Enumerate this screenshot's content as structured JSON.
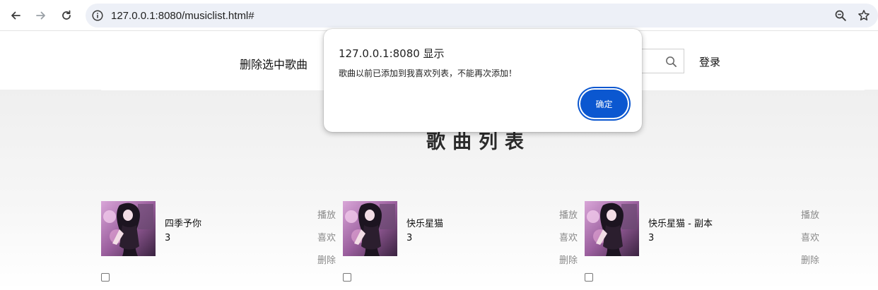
{
  "browser": {
    "url": "127.0.0.1:8080/musiclist.html#",
    "icons": [
      "back-arrow-icon",
      "forward-arrow-icon",
      "reload-icon",
      "site-info-icon",
      "zoom-icon",
      "bookmark-star-icon"
    ]
  },
  "header": {
    "delete_selected": "删除选中歌曲",
    "login": "登录"
  },
  "main": {
    "title": "歌曲列表",
    "songs": [
      {
        "name": "四季予你",
        "count": "3",
        "play": "播放",
        "like": "喜欢",
        "delete": "删除",
        "checked": false
      },
      {
        "name": "快乐星猫",
        "count": "3",
        "play": "播放",
        "like": "喜欢",
        "delete": "删除",
        "checked": false
      },
      {
        "name": "快乐星猫 - 副本",
        "count": "3",
        "play": "播放",
        "like": "喜欢",
        "delete": "删除",
        "checked": false
      }
    ]
  },
  "dialog": {
    "title": "127.0.0.1:8080 显示",
    "message": "歌曲以前已添加到我喜欢列表，不能再次添加！",
    "ok": "确定"
  },
  "colors": {
    "accent": "#0b57d0",
    "omnibox_bg": "#edf0f7",
    "action_text": "#8a8a8a"
  }
}
